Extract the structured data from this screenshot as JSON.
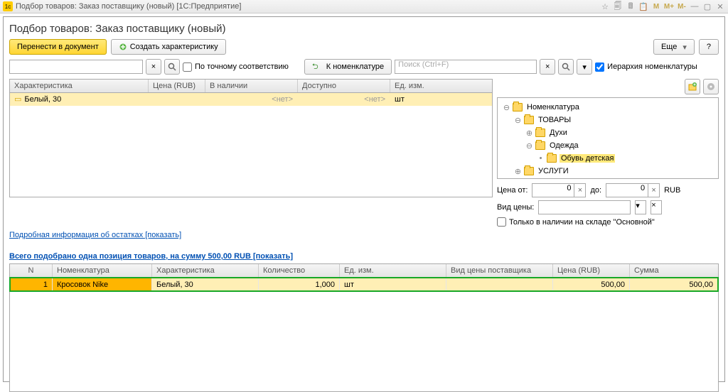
{
  "titlebar": {
    "text": "Подбор товаров: Заказ поставщику (новый)  [1С:Предприятие]",
    "m1": "M",
    "m2": "M+",
    "m3": "M-"
  },
  "heading": "Подбор товаров: Заказ поставщику (новый)",
  "toolbar": {
    "transfer": "Перенести в документ",
    "create_char": "Создать характеристику",
    "more": "Еще",
    "help": "?"
  },
  "search": {
    "exact": "По точному соответствию",
    "to_nomen": "К номенклатуре",
    "search_ph": "Поиск (Ctrl+F)",
    "hierarchy": "Иерархия номенклатуры"
  },
  "grid1": {
    "cols": {
      "char": "Характеристика",
      "price": "Цена (RUB)",
      "instock": "В наличии",
      "avail": "Доступно",
      "uom": "Ед. изм."
    },
    "row": {
      "char": "Белый, 30",
      "instock": "<нет>",
      "avail": "<нет>",
      "uom": "шт"
    }
  },
  "tree": {
    "root": "Номенклатура",
    "n1": "ТОВАРЫ",
    "n2": "Духи",
    "n3": "Одежда",
    "n4": "Обувь детская",
    "n5": "УСЛУГИ"
  },
  "filters": {
    "price_from": "Цена от:",
    "price_to": "до:",
    "zero": "0",
    "currency": "RUB",
    "price_type": "Вид цены:",
    "only_stock": "Только в наличии на складе \"Основной\""
  },
  "links": {
    "detail": "Подробная информация об остатках [показать]",
    "summary": "Всего подобрано одна позиция товаров, на сумму 500,00 RUB [показать]"
  },
  "grid2": {
    "cols": {
      "n": "N",
      "nomen": "Номенклатура",
      "char": "Характеристика",
      "qty": "Количество",
      "uom": "Ед. изм.",
      "ptype": "Вид цены поставщика",
      "price": "Цена (RUB)",
      "sum": "Сумма"
    },
    "row": {
      "n": "1",
      "nomen": "Кросовок Nike",
      "char": "Белый, 30",
      "qty": "1,000",
      "uom": "шт",
      "ptype": "",
      "price": "500,00",
      "sum": "500,00"
    }
  }
}
